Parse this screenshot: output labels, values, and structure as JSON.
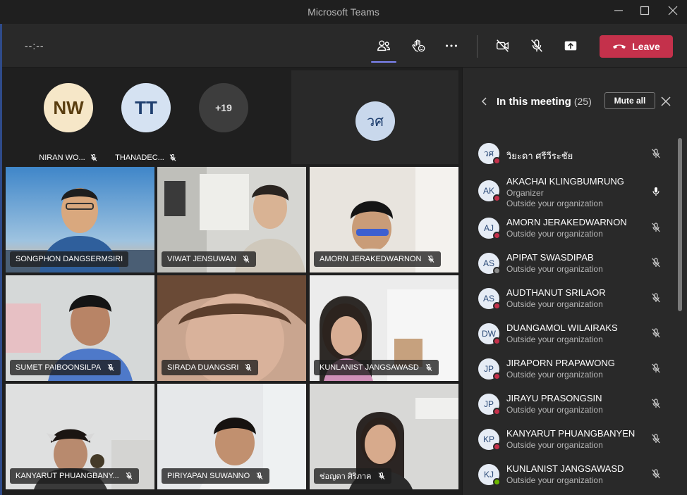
{
  "window": {
    "title": "Microsoft Teams"
  },
  "toolbar": {
    "timer": "--:--",
    "leave_label": "Leave"
  },
  "overflow": [
    {
      "initials": "NW",
      "name": "NIRAN WO...",
      "bg": "#f6e7c8",
      "fg": "#5a3e10"
    },
    {
      "initials": "TT",
      "name": "THANADEC...",
      "bg": "#d5e2f2",
      "fg": "#1f3f6f"
    },
    {
      "initials": "+19",
      "name": "",
      "bg": "#3d3d3d",
      "fg": "#e0e0e0"
    }
  ],
  "speaker": {
    "initials": "วศ"
  },
  "tiles": [
    {
      "name": "SONGPHON DANGSERMSIRI"
    },
    {
      "name": "VIWAT JENSUWAN"
    },
    {
      "name": "AMORN JERAKEDWARNON"
    },
    {
      "name": "SUMET PAIBOONSILPA"
    },
    {
      "name": "SIRADA DUANGSRI"
    },
    {
      "name": "KUNLANIST JANGSAWASD"
    },
    {
      "name": "KANYARUT PHUANGBANY..."
    },
    {
      "name": "PIRIYAPAN SUWANNO"
    },
    {
      "name": "ช่อญดา ศิริภาค"
    }
  ],
  "panel": {
    "title": "In this meeting",
    "count": "(25)",
    "mute_all_label": "Mute all",
    "participants": [
      {
        "initials": "วศ",
        "name": "วิยะดา ศรีวีระชัย",
        "role": "",
        "org": "",
        "status": "red"
      },
      {
        "initials": "AK",
        "name": "AKACHAI KLINGBUMRUNG",
        "role": "Organizer",
        "org": "Outside your organization",
        "status": "red"
      },
      {
        "initials": "AJ",
        "name": "AMORN JERAKEDWARNON",
        "role": "",
        "org": "Outside your organization",
        "status": "red"
      },
      {
        "initials": "AS",
        "name": "APIPAT SWASDIPAB",
        "role": "",
        "org": "Outside your organization",
        "status": "gray"
      },
      {
        "initials": "AS",
        "name": "AUDTHANUT SRILAOR",
        "role": "",
        "org": "Outside your organization",
        "status": "red"
      },
      {
        "initials": "DW",
        "name": "DUANGAMOL WILAIRAKS",
        "role": "",
        "org": "Outside your organization",
        "status": "red"
      },
      {
        "initials": "JP",
        "name": "JIRAPORN PRAPAWONG",
        "role": "",
        "org": "Outside your organization",
        "status": "red"
      },
      {
        "initials": "JP",
        "name": "JIRAYU PRASONGSIN",
        "role": "",
        "org": "Outside your organization",
        "status": "red"
      },
      {
        "initials": "KP",
        "name": "KANYARUT PHUANGBANYEN",
        "role": "",
        "org": "Outside your organization",
        "status": "red"
      },
      {
        "initials": "KJ",
        "name": "KUNLANIST JANGSAWASD",
        "role": "",
        "org": "Outside your organization",
        "status": "green"
      }
    ]
  },
  "colors": {
    "accent": "#7f85f5",
    "leave": "#c4314b",
    "busy": "#c4314b",
    "available": "#6bb700",
    "offline": "#8a8a8a"
  }
}
